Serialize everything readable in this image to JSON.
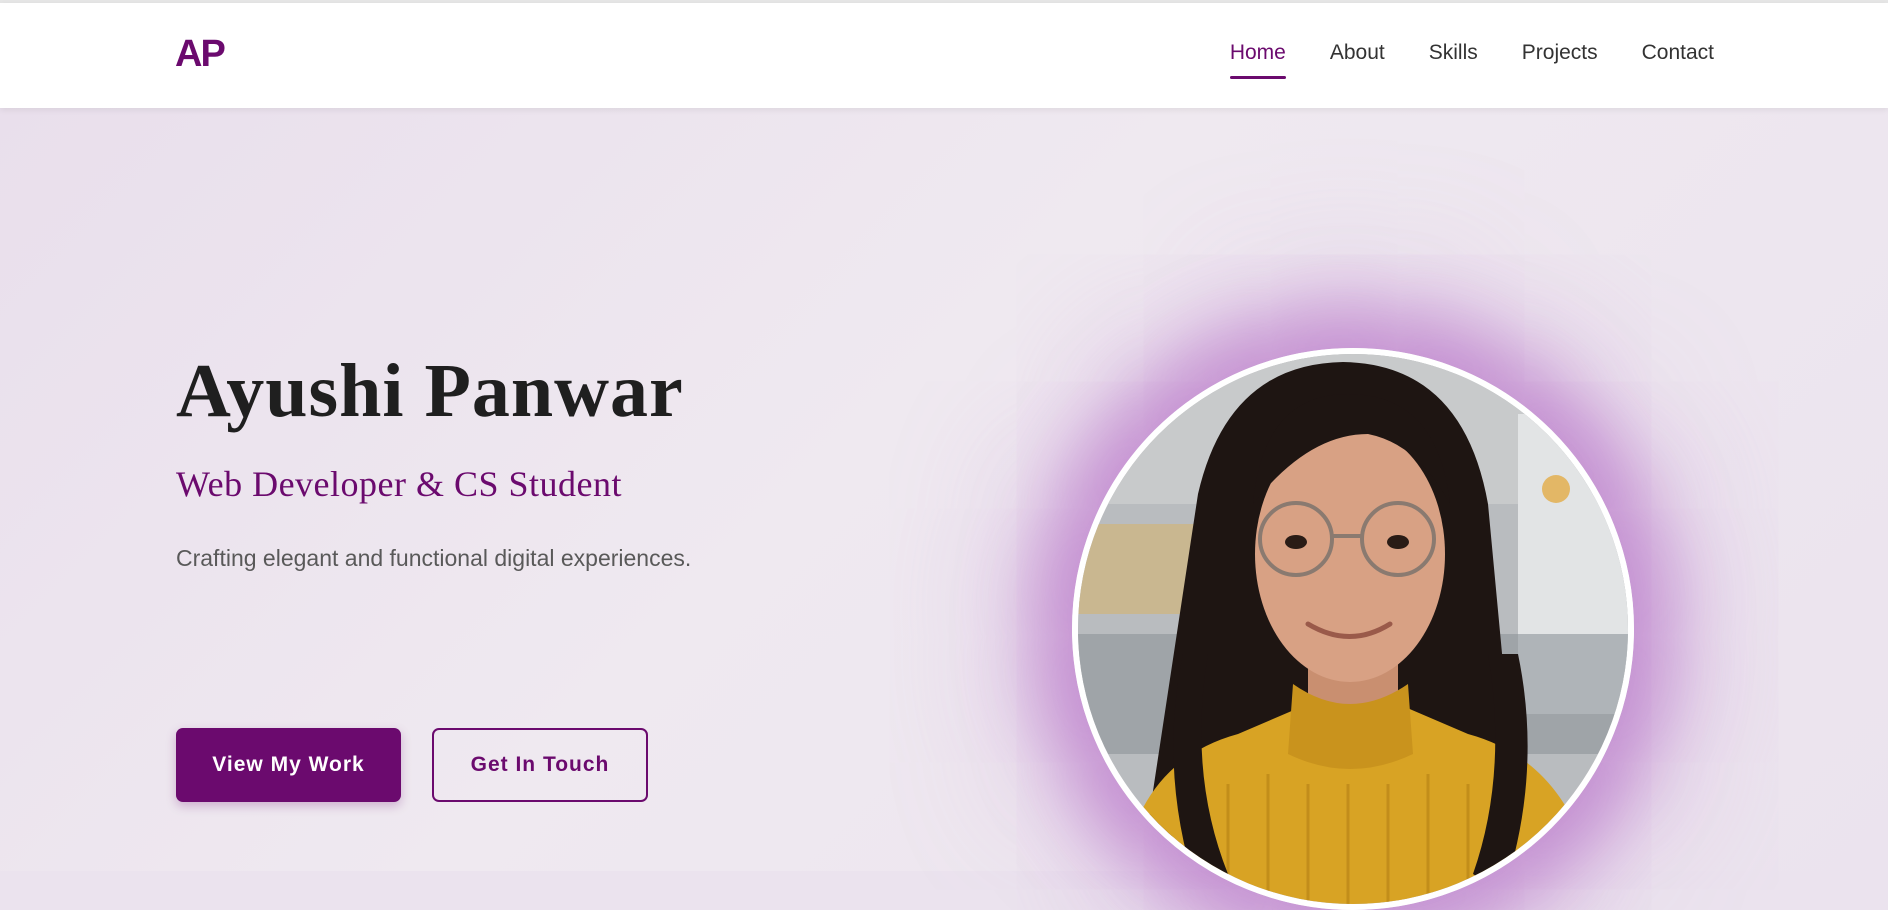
{
  "brand": {
    "logo": "AP",
    "accent_color": "#6b0a6e"
  },
  "nav": {
    "items": [
      {
        "label": "Home",
        "active": true
      },
      {
        "label": "About",
        "active": false
      },
      {
        "label": "Skills",
        "active": false
      },
      {
        "label": "Projects",
        "active": false
      },
      {
        "label": "Contact",
        "active": false
      }
    ]
  },
  "hero": {
    "name": "Ayushi Panwar",
    "subtitle": "Web Developer & CS Student",
    "tagline": "Crafting elegant and functional digital experiences.",
    "primary_button": "View My Work",
    "secondary_button": "Get In Touch",
    "portrait_icon": "profile-photo"
  }
}
